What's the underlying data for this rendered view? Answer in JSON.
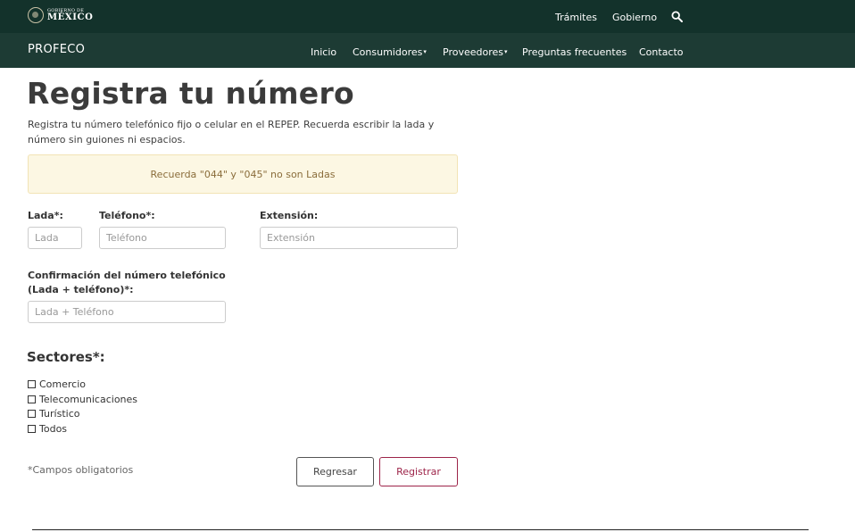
{
  "gov_bar": {
    "logo_small": "GOBIERNO DE",
    "logo_big": "MÉXICO",
    "links": [
      "Trámites",
      "Gobierno"
    ],
    "search_icon": "search-icon",
    "background": "#13322b"
  },
  "sub_nav": {
    "brand": "PROFECO",
    "items": [
      {
        "label": "Inicio",
        "caret": ""
      },
      {
        "label": "Consumidores",
        "caret": "▾"
      },
      {
        "label": "Proveedores",
        "caret": "▾"
      },
      {
        "label": "Preguntas frecuentes",
        "caret": ""
      },
      {
        "label": "Contacto",
        "caret": ""
      }
    ],
    "background": "#1d3b34"
  },
  "page": {
    "title": "Registra tu número",
    "intro": "Registra tu número telefónico fijo o celular en el REPEP. Recuerda escribir la lada y número sin guiones ni espacios.",
    "alert": "Recuerda \"044\" y \"045\" no son Ladas"
  },
  "form": {
    "lada_label": "Lada*:",
    "lada_placeholder": "Lada",
    "telefono_label": "Teléfono*:",
    "telefono_placeholder": "Teléfono",
    "extension_label": "Extensión:",
    "extension_placeholder": "Extensión",
    "confirm_label_1": "Confirmación del número telefónico",
    "confirm_label_2": "(Lada + teléfono)*:",
    "confirm_placeholder": "Lada + Teléfono",
    "sectores_label": "Sectores*:",
    "sectores": [
      "Comercio",
      "Telecomunicaciones",
      "Turístico",
      "Todos"
    ],
    "required_note": "*Campos obligatorios",
    "back_button": "Regresar",
    "submit_button": "Registrar",
    "accent_color": "#9d2449"
  }
}
